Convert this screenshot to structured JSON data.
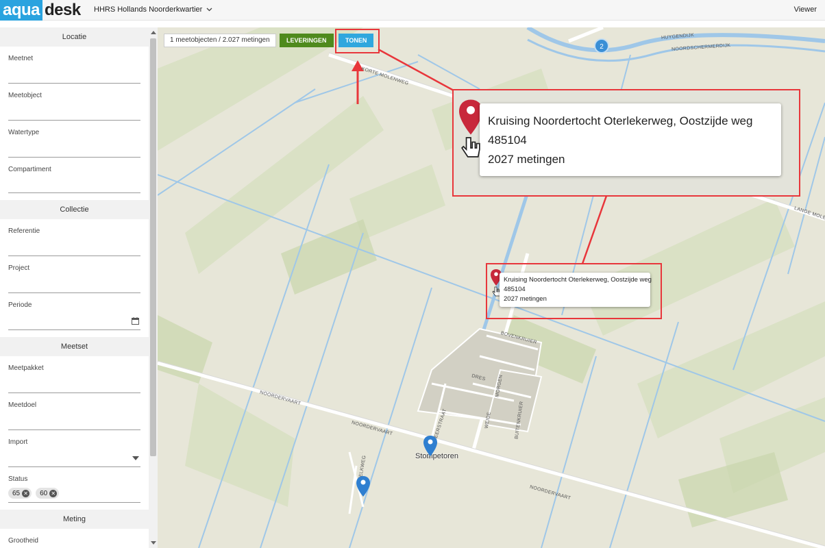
{
  "header": {
    "logo_part1": "aqua",
    "logo_part2": "desk",
    "organization": "HHRS Hollands Noorderkwartier",
    "role": "Viewer"
  },
  "sidebar": {
    "sections": [
      {
        "title": "Locatie",
        "fields": [
          "Meetnet",
          "Meetobject",
          "Watertype",
          "Compartiment"
        ]
      },
      {
        "title": "Collectie",
        "fields": [
          "Referentie",
          "Project",
          "Periode"
        ]
      },
      {
        "title": "Meetset",
        "fields": [
          "Meetpakket",
          "Meetdoel",
          "Import",
          "Status"
        ]
      },
      {
        "title": "Meting",
        "fields": [
          "Grootheid"
        ]
      }
    ],
    "status_chips": [
      "65",
      "60"
    ]
  },
  "map": {
    "summary": "1 meetobjecten / 2.027 metingen",
    "btn_leveringen": "LEVERINGEN",
    "btn_tonen": "TONEN",
    "cluster_count": "2",
    "place_name": "Stompetoren",
    "popup": {
      "title": "Kruising Noordertocht Oterlekerweg, Oostzijde weg",
      "code": "485104",
      "count": "2027 metingen"
    },
    "road_labels": {
      "korte_molenweg": "KORTE MOLENWEG",
      "huygendijk": "HUYGENDIJK",
      "noordschermerdijk": "NOORDSCHERMERDIJK",
      "lange_molenweg": "LANGE MOLE",
      "noordervaart_1": "NOORDERVAART",
      "noordervaart_2": "NOORDERVAART",
      "noordervaart_3": "NOORDERVAART",
      "bovenkruier": "BOVENKRUIER",
      "buitenkruier": "BUITENKRUIER",
      "melkweg": "MELKWEG",
      "schermeerstraat": "SCHERMEERSTRAAT",
      "weide": "WEIDE",
      "morgen": "MORGEN",
      "dres": "DRES"
    }
  },
  "colors": {
    "highlight": "#e8363b",
    "leveringen": "#4f8a1d",
    "tonen": "#30a7de",
    "water": "#9fc7e8"
  }
}
